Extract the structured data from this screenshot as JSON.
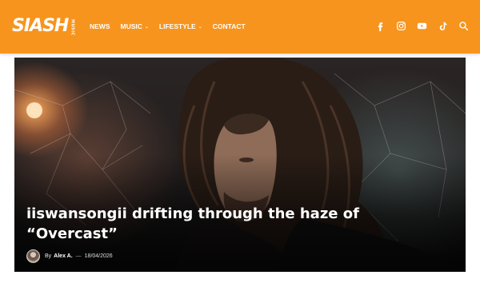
{
  "header": {
    "logo": {
      "text": "SIASH",
      "sub": "MUSIC"
    },
    "nav": [
      {
        "label": "NEWS",
        "has_dropdown": false
      },
      {
        "label": "MUSIC",
        "has_dropdown": true
      },
      {
        "label": "LIFESTYLE",
        "has_dropdown": true
      },
      {
        "label": "CONTACT",
        "has_dropdown": false
      }
    ],
    "icons": [
      "facebook-icon",
      "instagram-icon",
      "youtube-icon",
      "tiktok-icon",
      "search-icon"
    ],
    "colors": {
      "bar": "#f7941d",
      "text": "#ffffff"
    }
  },
  "hero": {
    "title": "iiswansongii drifting through the haze of “Overcast”",
    "by": "By",
    "author": "Alex A.",
    "separator": "—",
    "date": "18/04/2026"
  }
}
